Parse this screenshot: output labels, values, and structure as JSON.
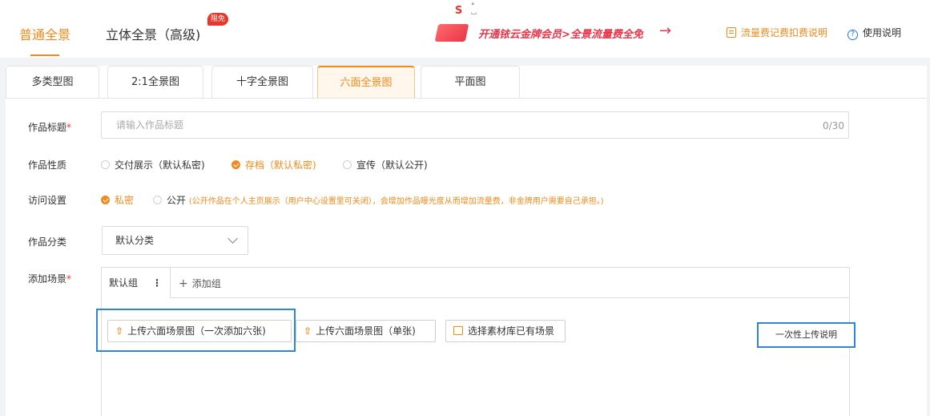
{
  "header": {
    "tabs": [
      {
        "label": "普通全景",
        "active": true
      },
      {
        "label": "立体全景（高级)",
        "active": false
      }
    ],
    "badge": "限免",
    "promo_text": "开通铱云金牌会员>全景流量费全免",
    "promo_arrow": "→",
    "fee_link": "流量费记费扣费说明",
    "help_link": "使用说明"
  },
  "subtabs": [
    {
      "label": "多类型图",
      "active": false
    },
    {
      "label": "2:1全景图",
      "active": false
    },
    {
      "label": "十字全景图",
      "active": false
    },
    {
      "label": "六面全景图",
      "active": true
    },
    {
      "label": "平面图",
      "active": false
    }
  ],
  "form": {
    "title_label": "作品标题",
    "title_placeholder": "请输入作品标题",
    "title_count": "0/30",
    "nature_label": "作品性质",
    "nature_options": [
      {
        "label": "交付展示（默认私密)",
        "checked": false
      },
      {
        "label": "存档（默认私密)",
        "checked": true
      },
      {
        "label": "宣传（默认公开)",
        "checked": false
      }
    ],
    "access_label": "访问设置",
    "access_private": "私密",
    "access_public": "公开",
    "access_public_note": "(公开作品在个人主页展示（用户中心设置里可关闭），会增加作品曝光度从而增加流量费，非金牌用户需要自己承担。)",
    "category_label": "作品分类",
    "category_value": "默认分类",
    "scene_label": "添加场景",
    "group_name": "默认组",
    "group_more": "⋮",
    "add_group": "添加组",
    "upload_six": "上传六面场景图（一次添加六张)",
    "upload_single": "上传六面场景图（单张)",
    "select_library": "选择素材库已有场景",
    "batch_explain": "一次性上传说明"
  },
  "colors": {
    "accent": "#f08a1c",
    "highlight": "#2f86d6",
    "promo": "#e8364a"
  }
}
